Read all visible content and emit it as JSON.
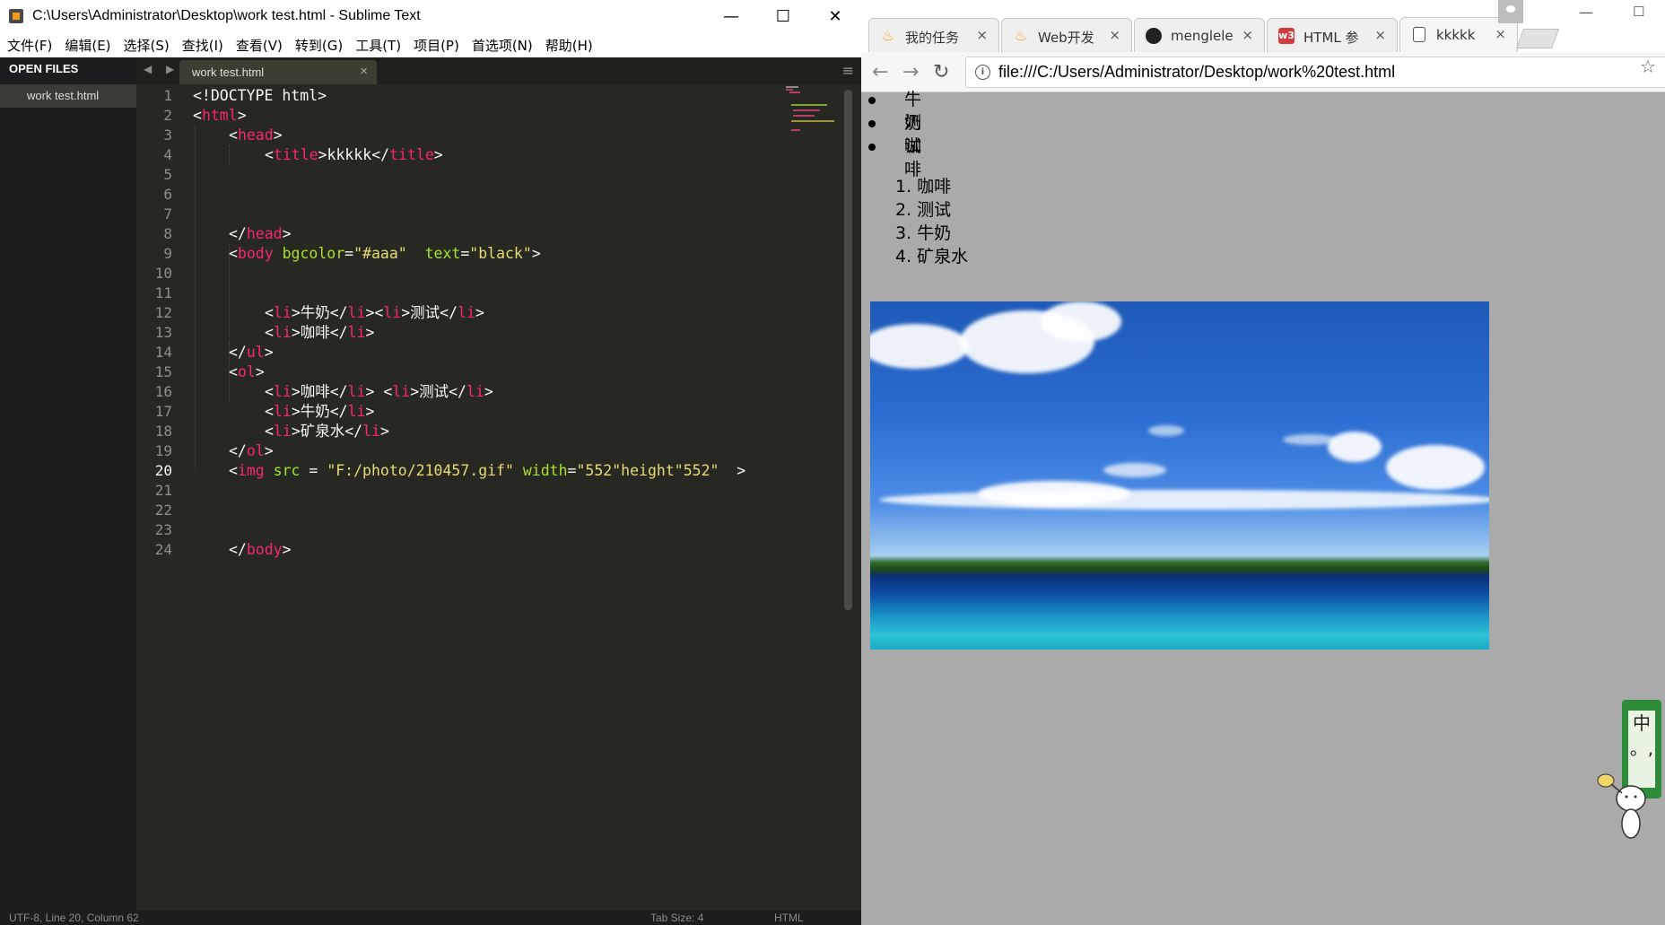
{
  "sublime": {
    "title": "C:\\Users\\Administrator\\Desktop\\work test.html - Sublime Text",
    "window_controls": {
      "minimize": "—",
      "maximize": "☐",
      "close": "✕"
    },
    "menu": [
      "文件(F)",
      "编辑(E)",
      "选择(S)",
      "查找(I)",
      "查看(V)",
      "转到(G)",
      "工具(T)",
      "项目(P)",
      "首选项(N)",
      "帮助(H)"
    ],
    "sidebar": {
      "header": "OPEN FILES",
      "files": [
        "work test.html"
      ]
    },
    "tab": {
      "label": "work test.html",
      "close": "×"
    },
    "nav_arrows": "◀ ▶",
    "tab_menu": "≡",
    "line_numbers": [
      "1",
      "2",
      "3",
      "4",
      "5",
      "6",
      "7",
      "8",
      "9",
      "10",
      "11",
      "12",
      "13",
      "14",
      "15",
      "16",
      "17",
      "18",
      "19",
      "20",
      "21",
      "22",
      "23",
      "24"
    ],
    "current_line": 20,
    "code": {
      "l1": "<!DOCTYPE html>",
      "l2": {
        "lt": "<",
        "tag": "html",
        "gt": ">"
      },
      "l3": {
        "lt": "<",
        "tag": "head",
        "gt": ">"
      },
      "l4": {
        "lt": "<",
        "tag": "title",
        "gt": ">",
        "text": "kkkkk",
        "clt": "</",
        "ctag": "title",
        "cgt": ">"
      },
      "l8": {
        "lt": "</",
        "tag": "head",
        "gt": ">"
      },
      "l9": {
        "lt": "<",
        "tag": "body",
        "attr1": " bgcolor",
        "eq1": "=",
        "val1": "\"#aaa\"",
        "attr2": "  text",
        "eq2": "=",
        "val2": "\"black\"",
        "gt": ">"
      },
      "l12": {
        "a": "<",
        "b": "li",
        "c": ">牛奶</",
        "d": "li",
        "e": "><",
        "f": "li",
        "g": ">测试</",
        "h": "li",
        "i": ">"
      },
      "l13": {
        "a": "<",
        "b": "li",
        "c": ">咖啡</",
        "d": "li",
        "e": ">"
      },
      "l14": {
        "a": "</",
        "b": "ul",
        "c": ">"
      },
      "l15": {
        "a": "<",
        "b": "ol",
        "c": ">"
      },
      "l16": {
        "a": "<",
        "b": "li",
        "c": ">咖啡</",
        "d": "li",
        "e": "> <",
        "f": "li",
        "g": ">测试</",
        "h": "li",
        "i": ">"
      },
      "l17": {
        "a": "<",
        "b": "li",
        "c": ">牛奶</",
        "d": "li",
        "e": ">"
      },
      "l18": {
        "a": "<",
        "b": "li",
        "c": ">矿泉水</",
        "d": "li",
        "e": ">"
      },
      "l19": {
        "a": "</",
        "b": "ol",
        "c": ">"
      },
      "l20": {
        "a": "<",
        "b": "img",
        "c": " src",
        "d": " = ",
        "e": "\"F:/photo/210457.gif\"",
        "f": " width",
        "g": "=",
        "h": "\"552\"",
        "i": "height",
        "j": "\"552\"",
        "k": "  >"
      },
      "l24": {
        "a": "</",
        "b": "body",
        "c": ">"
      }
    },
    "status": {
      "left": "UTF-8, Line 20, Column 62",
      "tab_size": "Tab Size: 4",
      "syntax": "HTML"
    },
    "colors": {
      "bg": "#272822",
      "tag": "#f92672",
      "attr": "#a6e22e",
      "string": "#e6db74",
      "text": "#f8f8f2"
    }
  },
  "chrome": {
    "tabs": [
      {
        "label": "我的任务",
        "favicon": "flame-icon",
        "close": "×"
      },
      {
        "label": "Web开发",
        "favicon": "flame-icon",
        "close": "×"
      },
      {
        "label": "menglele",
        "favicon": "github-icon",
        "close": "×"
      },
      {
        "label": "HTML 参",
        "favicon": "w3-icon",
        "favicon_text": "w3",
        "close": "×"
      },
      {
        "label": "kkkkk",
        "favicon": "page-icon",
        "close": "×"
      }
    ],
    "window_controls": {
      "minimize": "—",
      "maximize": "☐"
    },
    "nav": {
      "back": "←",
      "forward": "→",
      "reload": "↻"
    },
    "info_icon": "i",
    "url": "file:///C:/Users/Administrator/Desktop/work%20test.html",
    "star": "☆",
    "page": {
      "bgcolor": "#aaaaaa",
      "ul_items": [
        "牛奶",
        "测试",
        "咖啡"
      ],
      "ol_items": [
        "1. 咖啡",
        "2. 测试",
        "3. 牛奶",
        "4. 矿泉水"
      ]
    }
  },
  "ime": {
    "char": "中",
    "punct": "。,"
  }
}
